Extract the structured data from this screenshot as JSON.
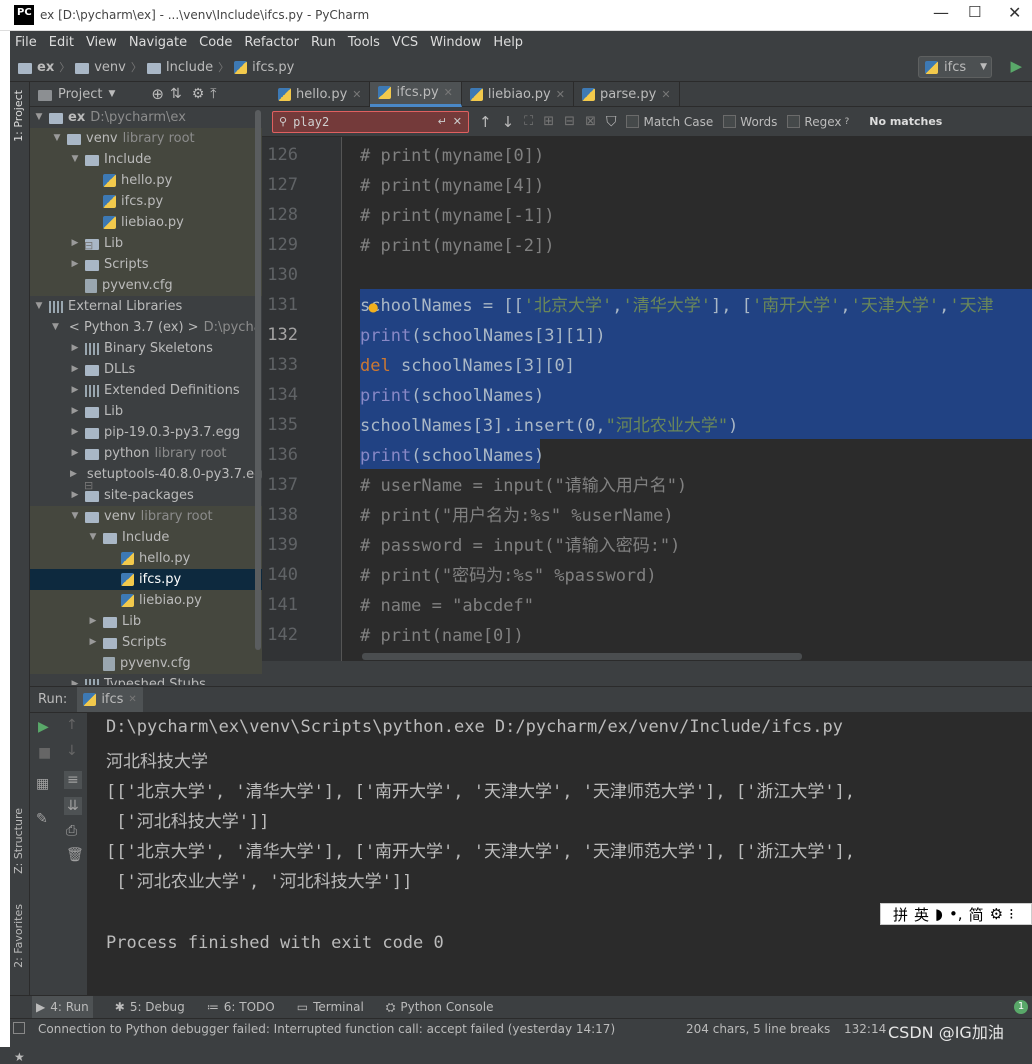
{
  "window": {
    "title": "ex [D:\\pycharm\\ex] - ...\\venv\\Include\\ifcs.py - PyCharm",
    "logo": "PC",
    "min": "—",
    "max": "☐",
    "close": "✕"
  },
  "menu": [
    "File",
    "Edit",
    "View",
    "Navigate",
    "Code",
    "Refactor",
    "Run",
    "Tools",
    "VCS",
    "Window",
    "Help"
  ],
  "breadcrumb": [
    "ex",
    "venv",
    "Include",
    "ifcs.py"
  ],
  "run_config": "ifcs",
  "left_strip": {
    "project": "1: Project",
    "structure": "Z: Structure",
    "favorites": "2: Favorites"
  },
  "project_panel": {
    "title": "Project"
  },
  "tree": [
    {
      "label": "ex",
      "extra": "D:\\pycharm\\ex",
      "arrow": "▼",
      "kind": "folder",
      "bold": true
    },
    {
      "label": "venv",
      "extra": "library root",
      "arrow": "▼",
      "kind": "folder"
    },
    {
      "label": "Include",
      "extra": "",
      "arrow": "▼",
      "kind": "folder"
    },
    {
      "label": "hello.py",
      "extra": "",
      "arrow": "",
      "kind": "py"
    },
    {
      "label": "ifcs.py",
      "extra": "",
      "arrow": "",
      "kind": "py"
    },
    {
      "label": "liebiao.py",
      "extra": "",
      "arrow": "",
      "kind": "py"
    },
    {
      "label": "Lib",
      "extra": "",
      "arrow": "▶",
      "kind": "folder"
    },
    {
      "label": "Scripts",
      "extra": "",
      "arrow": "▶",
      "kind": "folder"
    },
    {
      "label": "pyvenv.cfg",
      "extra": "",
      "arrow": "",
      "kind": "file"
    },
    {
      "label": "External Libraries",
      "extra": "",
      "arrow": "▼",
      "kind": "lib"
    },
    {
      "label": "< Python 3.7 (ex) >",
      "extra": "D:\\pycharm",
      "arrow": "▼",
      "kind": "py"
    },
    {
      "label": "Binary Skeletons",
      "extra": "",
      "arrow": "▶",
      "kind": "lib"
    },
    {
      "label": "DLLs",
      "extra": "",
      "arrow": "▶",
      "kind": "folder"
    },
    {
      "label": "Extended Definitions",
      "extra": "",
      "arrow": "▶",
      "kind": "lib"
    },
    {
      "label": "Lib",
      "extra": "",
      "arrow": "▶",
      "kind": "folder"
    },
    {
      "label": "pip-19.0.3-py3.7.egg",
      "extra": "",
      "arrow": "▶",
      "kind": "folder"
    },
    {
      "label": "python",
      "extra": "library root",
      "arrow": "▶",
      "kind": "folder"
    },
    {
      "label": "setuptools-40.8.0-py3.7.egg",
      "extra": "",
      "arrow": "▶",
      "kind": "folder"
    },
    {
      "label": "site-packages",
      "extra": "",
      "arrow": "▶",
      "kind": "folder"
    },
    {
      "label": "venv",
      "extra": "library root",
      "arrow": "▼",
      "kind": "folder"
    },
    {
      "label": "Include",
      "extra": "",
      "arrow": "▼",
      "kind": "folder"
    },
    {
      "label": "hello.py",
      "extra": "",
      "arrow": "",
      "kind": "py"
    },
    {
      "label": "ifcs.py",
      "extra": "",
      "arrow": "",
      "kind": "py",
      "selected": true
    },
    {
      "label": "liebiao.py",
      "extra": "",
      "arrow": "",
      "kind": "py"
    },
    {
      "label": "Lib",
      "extra": "",
      "arrow": "▶",
      "kind": "folder"
    },
    {
      "label": "Scripts",
      "extra": "",
      "arrow": "▶",
      "kind": "folder"
    },
    {
      "label": "pyvenv.cfg",
      "extra": "",
      "arrow": "",
      "kind": "file"
    },
    {
      "label": "Typeshed Stubs",
      "extra": "",
      "arrow": "▶",
      "kind": "lib"
    }
  ],
  "tabs": [
    {
      "label": "hello.py",
      "active": false
    },
    {
      "label": "ifcs.py",
      "active": true
    },
    {
      "label": "liebiao.py",
      "active": false
    },
    {
      "label": "parse.py",
      "active": false
    }
  ],
  "search": {
    "query": "play2",
    "match_case": "Match Case",
    "words": "Words",
    "regex": "Regex",
    "result": "No matches"
  },
  "editor": {
    "lines": [
      {
        "n": "126",
        "code": [
          [
            "cm",
            "# print(myname[0])"
          ]
        ]
      },
      {
        "n": "127",
        "code": [
          [
            "cm",
            "# print(myname[4])"
          ]
        ]
      },
      {
        "n": "128",
        "code": [
          [
            "cm",
            "# print(myname[-1])"
          ]
        ]
      },
      {
        "n": "129",
        "code": [
          [
            "cm",
            "# print(myname[-2])"
          ]
        ]
      },
      {
        "n": "130",
        "code": []
      },
      {
        "n": "131",
        "code": [
          [
            "pl",
            "schoolNames = [["
          ],
          [
            "str",
            "'北京大学'"
          ],
          [
            "pl",
            ","
          ],
          [
            "str",
            "'清华大学'"
          ],
          [
            "pl",
            "], ["
          ],
          [
            "str",
            "'南开大学'"
          ],
          [
            "pl",
            ","
          ],
          [
            "str",
            "'天津大学'"
          ],
          [
            "pl",
            ","
          ],
          [
            "str",
            "'天津"
          ]
        ]
      },
      {
        "n": "132",
        "code": [
          [
            "bi",
            "print"
          ],
          [
            "pl",
            "(schoolNames[3][1])"
          ]
        ]
      },
      {
        "n": "133",
        "code": [
          [
            "kw",
            "del "
          ],
          [
            "pl",
            "schoolNames[3][0]"
          ]
        ]
      },
      {
        "n": "134",
        "code": [
          [
            "bi",
            "print"
          ],
          [
            "pl",
            "(schoolNames)"
          ]
        ]
      },
      {
        "n": "135",
        "code": [
          [
            "pl",
            "schoolNames[3].insert(0,"
          ],
          [
            "str",
            "\"河北农业大学\""
          ],
          [
            "pl",
            ")"
          ]
        ]
      },
      {
        "n": "136",
        "code": [
          [
            "bi",
            "print"
          ],
          [
            "pl",
            "(schoolNames)"
          ]
        ]
      },
      {
        "n": "137",
        "code": [
          [
            "cm",
            "# userName = input(\"请输入用户名\")"
          ]
        ]
      },
      {
        "n": "138",
        "code": [
          [
            "cm",
            "# print(\"用户名为:%s\" %userName)"
          ]
        ]
      },
      {
        "n": "139",
        "code": [
          [
            "cm",
            "# password = input(\"请输入密码:\")"
          ]
        ]
      },
      {
        "n": "140",
        "code": [
          [
            "cm",
            "# print(\"密码为:%s\" %password)"
          ]
        ]
      },
      {
        "n": "141",
        "code": [
          [
            "cm",
            "# name = \"abcdef\""
          ]
        ]
      },
      {
        "n": "142",
        "code": [
          [
            "cm",
            "# print(name[0])"
          ]
        ]
      }
    ]
  },
  "run": {
    "label": "Run:",
    "tab": "ifcs",
    "output": [
      "D:\\pycharm\\ex\\venv\\Scripts\\python.exe D:/pycharm/ex/venv/Include/ifcs.py",
      "河北科技大学",
      "[['北京大学', '清华大学'], ['南开大学', '天津大学', '天津师范大学'], ['浙江大学'],",
      " ['河北科技大学']]",
      "[['北京大学', '清华大学'], ['南开大学', '天津大学', '天津师范大学'], ['浙江大学'],",
      " ['河北农业大学', '河北科技大学']]",
      "",
      "Process finished with exit code 0"
    ]
  },
  "toolwindows": [
    "4: Run",
    "5: Debug",
    "6: TODO",
    "Terminal",
    "Python Console"
  ],
  "status": {
    "message": "Connection to Python debugger failed: Interrupted function call: accept failed (yesterday 14:17)",
    "chars": "204 chars, 5 line breaks",
    "position": "132:14",
    "watermark": "CSDN @IG加油",
    "badge": "1"
  },
  "ime": [
    "拼",
    "英",
    "◗",
    "•,",
    "简",
    "⚙",
    "⁝"
  ]
}
